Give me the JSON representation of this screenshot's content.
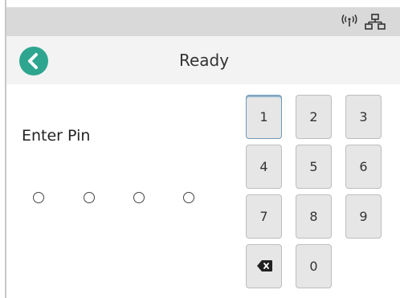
{
  "status_bar": {
    "icons": [
      "wireless-icon",
      "network-icon"
    ]
  },
  "header": {
    "back_icon": "chevron-left-icon",
    "title": "Ready",
    "accent_color": "#2ea58f"
  },
  "pin": {
    "label": "Enter Pin",
    "digits_entered": 0,
    "max_digits": 4
  },
  "keypad": {
    "keys": [
      "1",
      "2",
      "3",
      "4",
      "5",
      "6",
      "7",
      "8",
      "9",
      "",
      "0"
    ],
    "backspace_icon": "backspace-icon",
    "selected_key": "1"
  }
}
